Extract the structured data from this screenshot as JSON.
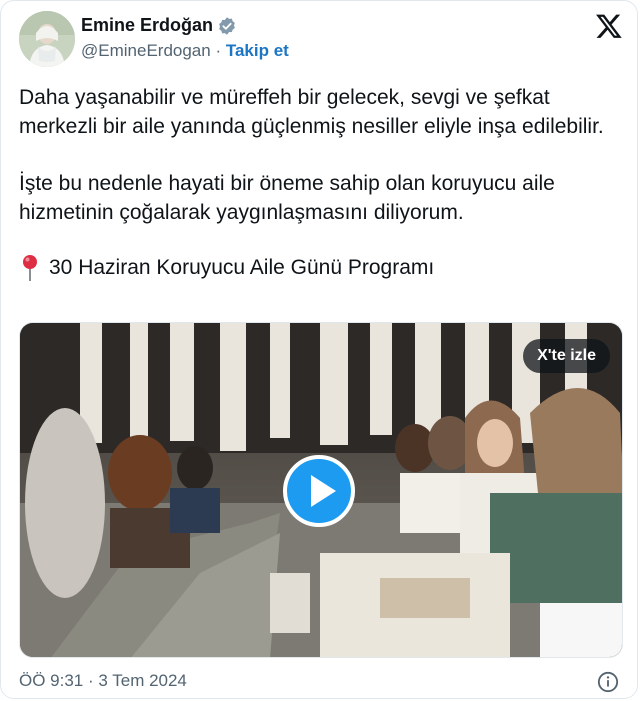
{
  "author": {
    "name": "Emine Erdoğan",
    "handle": "@EmineErdogan",
    "separator": "·",
    "follow_label": "Takip et",
    "verified": true
  },
  "tweet": {
    "paragraph1": "Daha yaşanabilir ve müreffeh bir gelecek, sevgi ve şefkat merkezli bir aile yanında güçlenmiş nesiller eliyle inşa edilebilir.",
    "paragraph2": "İşte bu nedenle hayati bir öneme sahip olan koruyucu aile hizmetinin çoğalarak yaygınlaşmasını diliyorum.",
    "program_line": "30 Haziran Koruyucu Aile Günü Programı"
  },
  "media": {
    "watch_label": "X'te izle"
  },
  "footer": {
    "timestamp": "ÖÖ 9:31 · 3 Tem 2024"
  },
  "colors": {
    "link": "#1d76c3",
    "play_button": "#1d9bf0",
    "verified_badge": "#829aab",
    "muted_text": "#536471"
  },
  "icons": [
    "verified-badge-icon",
    "x-logo-icon",
    "round-pushpin-icon",
    "play-icon",
    "info-icon"
  ]
}
